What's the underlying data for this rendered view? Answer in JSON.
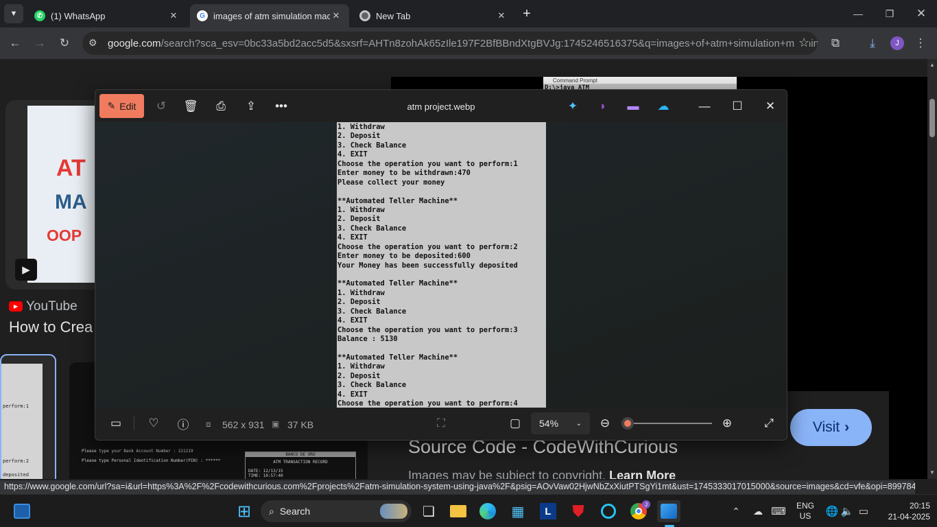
{
  "browser": {
    "tabs": [
      {
        "title": "(1) WhatsApp",
        "icon": "whatsapp-icon",
        "active": false
      },
      {
        "title": "images of atm simulation mach",
        "icon": "google-icon",
        "active": true
      },
      {
        "title": "New Tab",
        "icon": "chrome-icon",
        "active": false
      }
    ],
    "url_host": "google.com",
    "url_rest": "/search?sca_esv=0bc33a5bd2acc5d5&sxsrf=AHTn8zohAk65zIle197F2BfBBndXtgBVJg:1745246516375&q=images+of+atm+simulation+machine+p...",
    "profile_initial": "J",
    "status_url": "https://www.google.com/url?sa=i&url=https%3A%2F%2Fcodewithcurious.com%2Fprojects%2Fatm-simulation-system-using-java%2F&psig=AOvVaw02HjwNbZxXiutPTSgYi1mt&ust=1745333017015000&source=images&cd=vfe&opi=89978449&ve..."
  },
  "page": {
    "thumb_text_1": "AT",
    "thumb_text_2": "MA",
    "thumb_text_3": "OOP",
    "source_name": "YouTube",
    "result_title": "How to Crea",
    "cmd_title": "Command Prompt",
    "cmd_line": "D:\\>java ATM",
    "preview_title": "Source Code - CodeWithCurious",
    "copyright_text": "Images may be subject to copyright.",
    "learn_more": "Learn More",
    "visit_label": "Visit",
    "left_thumb_lines": [
      "perform:1",
      "perform:2",
      "deposited"
    ],
    "mid_thumb_lines": [
      "Please type your Bank Account Number : 221219",
      "Please type Personal Identification Number(PIN) : ******"
    ],
    "right_thumb_lines": [
      "BANCO DE ORO",
      "ATM TRANSACTION RECORD",
      "DATE:   12/13/15",
      "TIME:   10:57:40"
    ]
  },
  "viewer": {
    "edit_label": "Edit",
    "filename": "atm project.webp",
    "dimensions": "562 x 931",
    "filesize": "37 KB",
    "zoom": "54%",
    "zoom_level": 0.07,
    "terminal_lines": [
      "1. Withdraw",
      "2. Deposit",
      "3. Check Balance",
      "4. EXIT",
      "Choose the operation you want to perform:1",
      "Enter money to be withdrawn:470",
      "Please collect your money",
      "",
      "**Automated Teller Machine**",
      "1. Withdraw",
      "2. Deposit",
      "3. Check Balance",
      "4. EXIT",
      "Choose the operation you want to perform:2",
      "Enter money to be deposited:600",
      "Your Money has been successfully deposited",
      "",
      "**Automated Teller Machine**",
      "1. Withdraw",
      "2. Deposit",
      "3. Check Balance",
      "4. EXIT",
      "Choose the operation you want to perform:3",
      "Balance : 5130",
      "",
      "**Automated Teller Machine**",
      "1. Withdraw",
      "2. Deposit",
      "3. Check Balance",
      "4. EXIT",
      "Choose the operation you want to perform:4"
    ]
  },
  "taskbar": {
    "search_label": "Search",
    "lang_1": "ENG",
    "lang_2": "US",
    "time": "20:15",
    "date": "21-04-2025",
    "chrome_badge": "J",
    "lens_letter": "L"
  },
  "colors": {
    "edit_accent": "#f07b5f",
    "visit_button": "#8ab4f8",
    "terminal_bg": "#c8c8c8",
    "youtube_red": "#ff0000"
  }
}
